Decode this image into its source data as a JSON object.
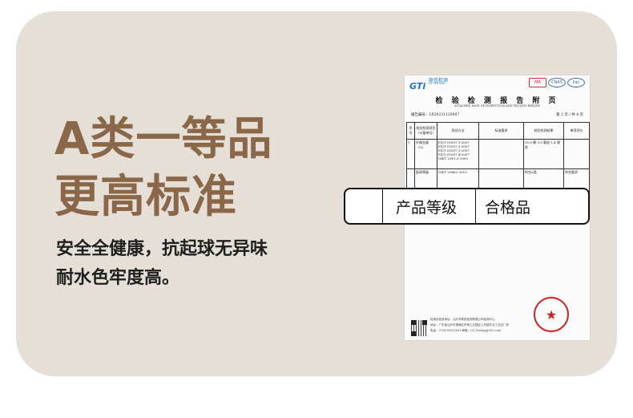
{
  "headline": {
    "line1": "A类一等品",
    "line2": "更高标准"
  },
  "description": {
    "line1": "安全全健康，抗起球无异味",
    "line2": "耐水色牢度高。"
  },
  "report": {
    "logo_mark": "GTi",
    "logo_text": "联信检测",
    "logo_sub": "LX TESTING",
    "cert_labels": [
      "MA",
      "CNAS",
      "ilac"
    ],
    "title": "检 验 检 测 报 告 附 页",
    "subtitle": "ATTACHED PAGE OF INSPECTION AND TESTING REPORT",
    "report_no": "报告编号：LX20231120007",
    "page": "第 2 页 / 共 4 页",
    "table_headers": [
      "序号",
      "检验检测项目（计量单位）",
      "测试方法",
      "标准要求",
      "检验检测结果",
      "单项评价"
    ],
    "row1": {
      "no": "1",
      "item": "纤维含量（%）",
      "methods": "FZ/T 01057.1-2007 FZ/T 01057.2-2007 FZ/T 01057.3-2007 FZ/T 01057.4-2007 GB/T 2910.3-2009",
      "result": "95.6 棉 3.0 氨纶 1.4 锦纶"
    },
    "row2": {
      "item": "起球等级",
      "method": "GB/T 29862-2013",
      "result": "符合A类",
      "eval": "符合要求"
    },
    "stamp_glyph": "★",
    "footer_lines": [
      "检测实验室地址：汕头市联信检测有限公司检测中心",
      "地址：广东省汕头市澄海区岭海工业园区上华镇东北工业区厂房",
      "电话：0754-85910003    邮箱：LX_Testing@163.com"
    ]
  },
  "overlay": {
    "label_cell": "产品等级",
    "value_cell": "合格品"
  }
}
